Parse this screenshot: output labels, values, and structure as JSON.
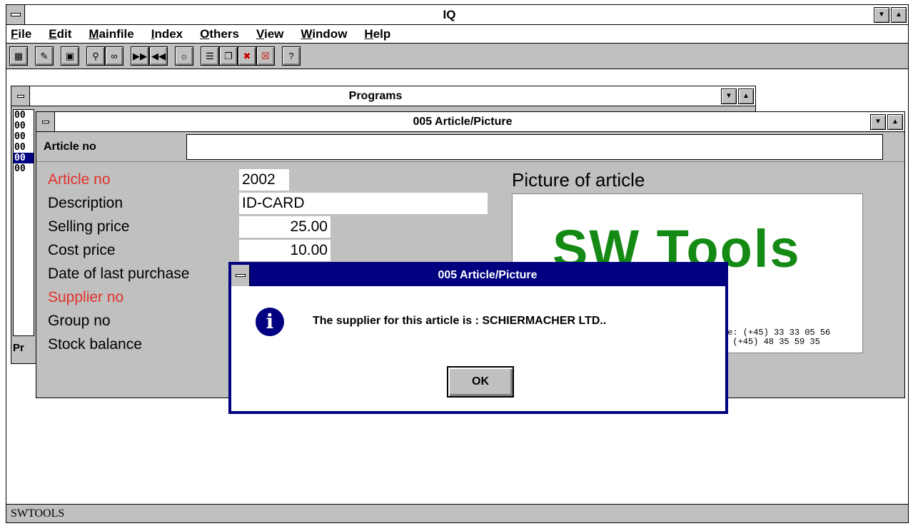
{
  "app": {
    "title": "IQ"
  },
  "menu": [
    "File",
    "Edit",
    "Mainfile",
    "Index",
    "Others",
    "View",
    "Window",
    "Help"
  ],
  "toolbar": {
    "groups": [
      [
        "calculator-icon"
      ],
      [
        "edit-record-icon"
      ],
      [
        "save-icon"
      ],
      [
        "search-icon",
        "glasses-icon"
      ],
      [
        "next-icon",
        "previous-icon"
      ],
      [
        "lightbulb-icon"
      ],
      [
        "tile-icon",
        "cascade-icon",
        "close-window-icon",
        "close-all-icon"
      ],
      [
        "help-icon"
      ]
    ]
  },
  "programs": {
    "title": "Programs",
    "items": [
      "00",
      "00",
      "00",
      "00",
      "00",
      "00"
    ],
    "selected_index": 4,
    "status": "Pr"
  },
  "article": {
    "title": "005  Article/Picture",
    "search_label": "Article no",
    "search_value": "",
    "fields": [
      {
        "label": "Article no",
        "value": "2002",
        "required": true
      },
      {
        "label": "Description",
        "value": "ID-CARD",
        "required": false
      },
      {
        "label": "Selling price",
        "value": "25.00",
        "required": false
      },
      {
        "label": "Cost price",
        "value": "10.00",
        "required": false
      },
      {
        "label": "Date of last purchase",
        "value": "",
        "required": false
      },
      {
        "label": "Supplier no",
        "value": "",
        "required": true
      },
      {
        "label": "Group no",
        "value": "",
        "required": false
      },
      {
        "label": "Stock balance",
        "value": "",
        "required": false
      }
    ],
    "picture_title": "Picture of article",
    "picture": {
      "logo_text": "SW Tools",
      "contact_lines": [
        "me:  (+45) 33 33 05 56",
        ":    (+45) 48 35 59 35"
      ]
    }
  },
  "dialog": {
    "title": "005 Article/Picture",
    "message": "The supplier for this article is : SCHIERMACHER LTD..",
    "ok_label": "OK"
  },
  "status_bar": {
    "text": "SWTOOLS"
  },
  "colors": {
    "required_label": "#e0312b",
    "dialog_title": "#000080",
    "logo_green": "#148a14",
    "chrome": "#c0c0c0"
  }
}
